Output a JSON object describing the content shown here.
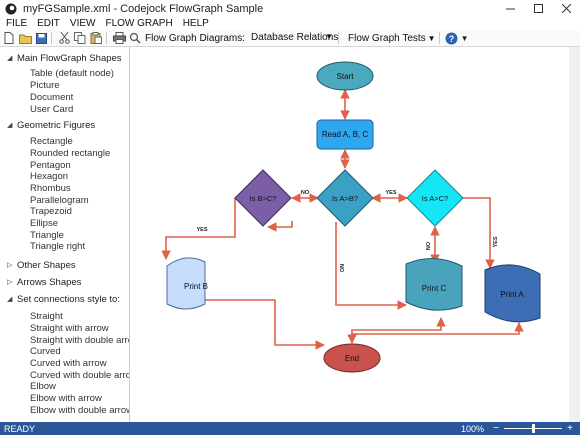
{
  "window": {
    "title": "myFGSample.xml - Codejock FlowGraph Sample"
  },
  "menu": [
    "FILE",
    "EDIT",
    "VIEW",
    "FLOW GRAPH",
    "HELP"
  ],
  "toolbar": {
    "diagrams_label": "Flow Graph Diagrams:",
    "diagrams_value": "Database Relations",
    "tests_label": "Flow Graph Tests"
  },
  "sidebar": {
    "sections": [
      {
        "label": "Main FlowGraph Shapes",
        "expanded": true,
        "items": [
          "Table (default node)",
          "Picture",
          "Document",
          "User Card"
        ]
      },
      {
        "label": "Geometric Figures",
        "expanded": true,
        "items": [
          "Rectangle",
          "Rounded rectangle",
          "Pentagon",
          "Hexagon",
          "Rhombus",
          "Parallelogram",
          "Trapezoid",
          "Ellipse",
          "Triangle",
          "Triangle right"
        ]
      },
      {
        "label": "Other Shapes",
        "expanded": false,
        "items": []
      },
      {
        "label": "Arrows Shapes",
        "expanded": false,
        "items": []
      },
      {
        "label": "Set connections style to:",
        "expanded": true,
        "items": [
          "Straight",
          "Straight with arrow",
          "Straight with double arrow",
          "Curved",
          "Curved with arrow",
          "Curved with double arrow",
          "Elbow",
          "Elbow with arrow",
          "Elbow with double arrow"
        ]
      }
    ]
  },
  "diagram": {
    "start": "Start",
    "read": "Read A, B, C",
    "is_b_gt_c": "Is B>C?",
    "is_a_gt_b": "Is A>B?",
    "is_a_gt_c": "Is A>C?",
    "print_b": "Print B",
    "print_c": "Print C",
    "print_a": "Print A",
    "end": "End",
    "lbl_no_1": "NO",
    "lbl_yes_1": "YES",
    "lbl_yes_2": "YES",
    "lbl_no_2": "NO",
    "lbl_no_3": "NO",
    "lbl_yes_3": "YES"
  },
  "colors": {
    "ellipse_teal": "#4aa8bf",
    "rect_blue": "#2ea7f0",
    "diamond_purple": "#7c5ea6",
    "diamond_teal": "#3aa0c4",
    "diamond_cyan": "#14e6f5",
    "print_b": "#c5dcfa",
    "print_c": "#4aa3bd",
    "print_a": "#3d6db5",
    "end": "#c9524c",
    "connector": "#e0604a",
    "statusbar": "#2b579a"
  },
  "status": {
    "text": "READY",
    "zoom": "100%",
    "zoom_fraction": 0.5
  }
}
